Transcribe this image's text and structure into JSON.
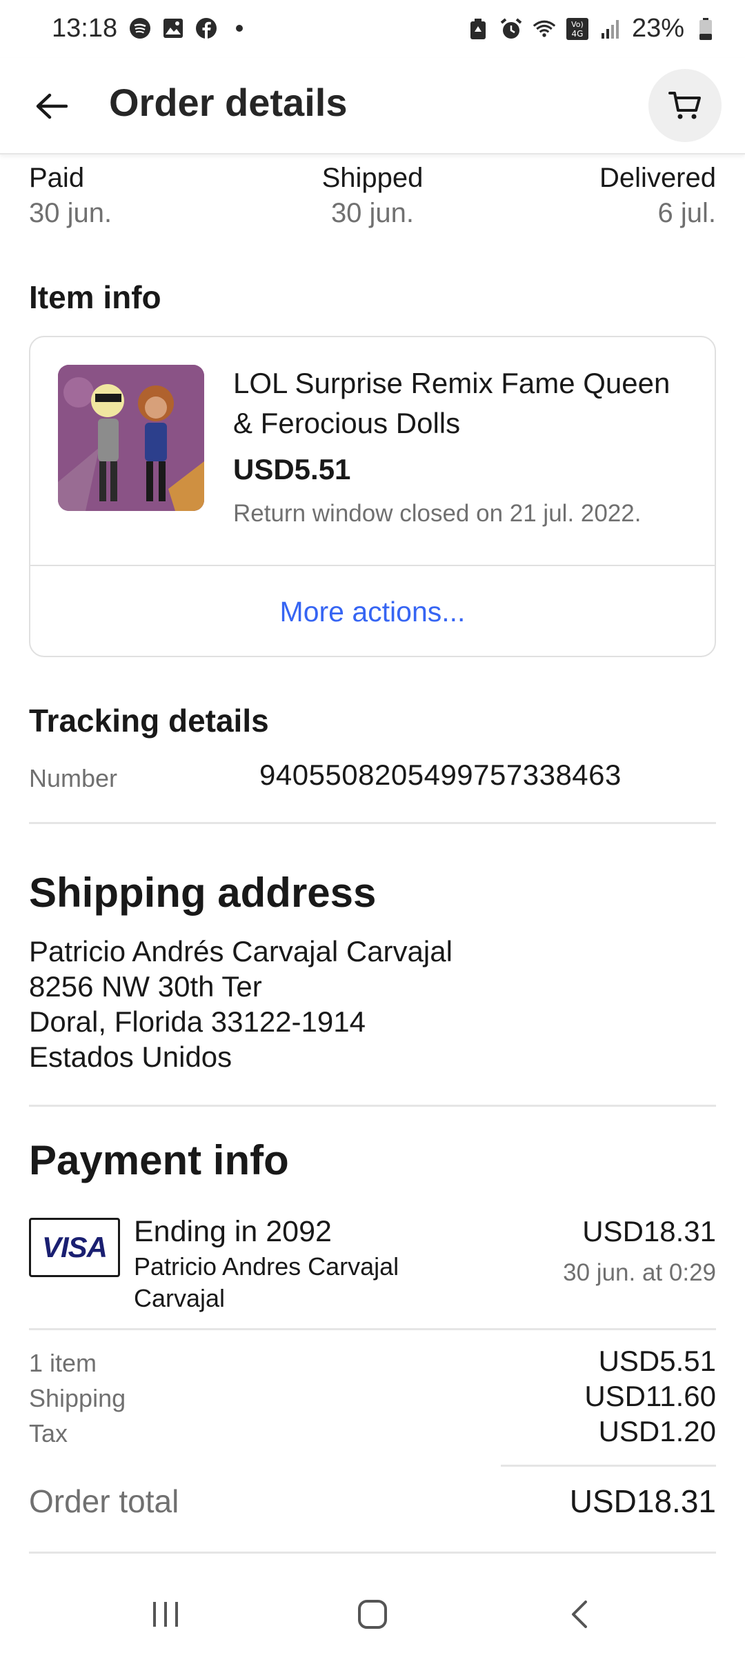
{
  "status_bar": {
    "time": "13:18",
    "battery": "23%",
    "icons_left": [
      "spotify-icon",
      "gallery-icon",
      "facebook-icon",
      "dot-icon"
    ],
    "icons_right": [
      "recycle-icon",
      "alarm-icon",
      "wifi-icon",
      "volte-icon",
      "signal-icon",
      "battery-icon"
    ],
    "volte_text": "Vo)\n4G"
  },
  "header": {
    "title": "Order details"
  },
  "progress": [
    {
      "label": "Paid",
      "date": "30 jun."
    },
    {
      "label": "Shipped",
      "date": "30 jun."
    },
    {
      "label": "Delivered",
      "date": "6 jul."
    }
  ],
  "item_info": {
    "heading": "Item info",
    "title": "LOL Surprise Remix Fame Queen & Ferocious Dolls",
    "price": "USD5.51",
    "return_note": "Return window closed on 21 jul. 2022.",
    "more_actions": "More actions..."
  },
  "tracking": {
    "heading": "Tracking details",
    "label": "Number",
    "number": "9405508205499757338463"
  },
  "shipping_address": {
    "heading": "Shipping address",
    "lines": [
      "Patricio Andrés  Carvajal Carvajal",
      "8256 NW 30th Ter",
      "Doral, Florida 33122-1914",
      "Estados Unidos"
    ]
  },
  "payment": {
    "heading": "Payment info",
    "card_brand": "VISA",
    "card_ending": "Ending in 2092",
    "holder": "Patricio Andres Carvajal Carvajal",
    "amount": "USD18.31",
    "date": "30 jun. at 0:29",
    "summary": [
      {
        "label": "1 item",
        "value": "USD5.51"
      },
      {
        "label": "Shipping",
        "value": "USD11.60"
      },
      {
        "label": "Tax",
        "value": "USD1.20"
      }
    ],
    "total_label": "Order total",
    "total_value": "USD18.31"
  },
  "colors": {
    "link": "#3665f3",
    "muted": "#707070",
    "text": "#191919",
    "visa": "#1a1f71"
  }
}
